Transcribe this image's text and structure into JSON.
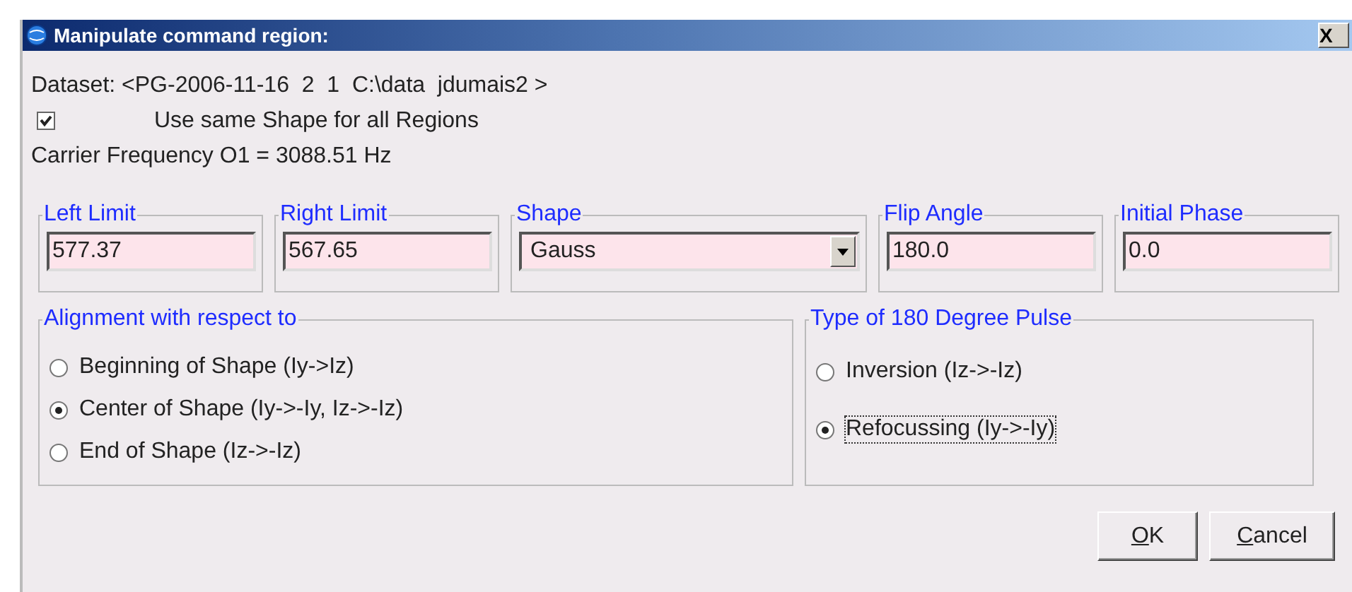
{
  "window": {
    "title": "Manipulate command region:",
    "close": "X"
  },
  "dataset": "Dataset: <PG-2006-11-16  2  1  C:\\data  jdumais2 >",
  "same_shape": {
    "label": "Use same Shape for all Regions",
    "checked": true
  },
  "carrier": "Carrier Frequency O1 = 3088.51 Hz",
  "fields": [
    {
      "kind": "text",
      "label": "Left Limit",
      "value": "577.37"
    },
    {
      "kind": "text",
      "label": "Right Limit",
      "value": "567.65"
    },
    {
      "kind": "dropdown",
      "label": "Shape",
      "value": "Gauss"
    },
    {
      "kind": "text",
      "label": "Flip Angle",
      "value": "180.0"
    },
    {
      "kind": "text",
      "label": "Initial Phase",
      "value": "0.0"
    }
  ],
  "alignment": {
    "title": "Alignment with respect to",
    "options": [
      {
        "label": "Beginning of Shape (Iy->Iz)",
        "selected": false
      },
      {
        "label": "Center of Shape (Iy->-Iy, Iz->-Iz)",
        "selected": true
      },
      {
        "label": "End of Shape (Iz->-Iz)",
        "selected": false
      }
    ]
  },
  "pulse": {
    "title": "Type of 180 Degree Pulse",
    "options": [
      {
        "label": "Inversion (Iz->-Iz)",
        "selected": false,
        "focused": false
      },
      {
        "label": "Refocussing (Iy->-Iy)",
        "selected": true,
        "focused": true
      }
    ]
  },
  "buttons": [
    {
      "mnemonic": "O",
      "rest": "K"
    },
    {
      "mnemonic": "C",
      "rest": "ancel"
    }
  ]
}
